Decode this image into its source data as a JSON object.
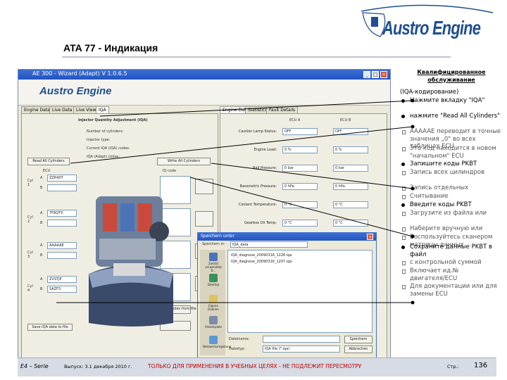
{
  "header": {
    "brand": "Austro Engine",
    "slide_title": "ATA 77 - Индикация"
  },
  "window": {
    "title": "AE 300 - Wizard (Adapt) V 1.0.6.5",
    "app_logo": "Austro Engine",
    "left_tabs": [
      "Engine Data",
      "Live Data",
      "Live View",
      "IQA"
    ],
    "right_tabs": [
      "Engine Data",
      "Statistics",
      "Fault Details"
    ],
    "panel_heading": "Injector Quantity Adjustment (IQA)",
    "left_labels": [
      "Number of cylinders:",
      "Injector type:",
      "Current IQA (IQA) codes:",
      "IQA (Adapt) codes:"
    ],
    "read_button": "Read All Cylinders",
    "write_button": "Write All Cylinders",
    "cyl_group": "ECU",
    "cyls": [
      {
        "label": "Cyl 1",
        "a": "A",
        "b": "B",
        "code": "ZZR40T"
      },
      {
        "label": "Cyl 2",
        "a": "A",
        "b": "B",
        "code": "7F8QT0"
      },
      {
        "label": "Cyl 3",
        "a": "A",
        "b": "B",
        "code": "AAAAAE"
      },
      {
        "label": "Cyl 4",
        "a": "A",
        "b": "B",
        "code": "ZVSTJP"
      }
    ],
    "cyl4_code_b": "SAZF3",
    "new_codes_label": "IQ code",
    "load_button": "Load codes from file",
    "save_button": "Save IQA data to file",
    "right_fields": [
      {
        "label": "Caution Lamp Status:",
        "v1": "OFF",
        "v2": "OFF"
      },
      {
        "label": "Engine Load:",
        "v1": "0 %",
        "v2": "0 %"
      },
      {
        "label": "Rail Pressure:",
        "v1": "0 bar",
        "v2": "0 bar"
      },
      {
        "label": "Barometric Pressure:",
        "v1": "0 hPa",
        "v2": "0 hPa"
      },
      {
        "label": "Coolant Temperature:",
        "v1": "0 °C",
        "v2": "0 °C"
      },
      {
        "label": "Gearbox Oil Temp:",
        "v1": "0 °C",
        "v2": "0 °C"
      },
      {
        "label": "Engine Speed:",
        "v1": "0 rpm",
        "v2": "0 rpm"
      },
      {
        "label": "Propeller Speed:",
        "v1": "0 rpm",
        "v2": "0 rpm"
      },
      {
        "label": "Oil Pressure:",
        "v1": "0 bar",
        "v2": "0 bar"
      }
    ],
    "right_col_heads": [
      "ECU A",
      "ECU B"
    ]
  },
  "dialog": {
    "title": "Speichern unter",
    "save_in_label": "Speichern in:",
    "save_in_value": "IQA_data",
    "places": [
      "Zuletzt verwendete D...",
      "Desktop",
      "Eigene Dateien",
      "Arbeitsplatz",
      "Netzwerkumgebung"
    ],
    "files": [
      "IQA_diagnose_20090316_1226.iqa",
      "IQA_diagnose_20090316_1207.iqa"
    ],
    "filename_label": "Dateiname:",
    "filetype_label": "Dateityp:",
    "filename_value": "IQA file (*.iqa)",
    "save_btn": "Speichern",
    "cancel_btn": "Abbrechen"
  },
  "notes": [
    {
      "kind": "head",
      "text": "Квалифицированное обслуживание"
    },
    {
      "kind": "plain",
      "text": "(IQA-кодирование)"
    },
    {
      "kind": "bul",
      "text": "Нажмите вкладку \"IQA\""
    },
    {
      "kind": "bul",
      "text": "нажмите \"Read All Cylinders\""
    },
    {
      "kind": "sub",
      "text": "AAAAAE переводит в точные значения „0\" во всех таблицах ECU"
    },
    {
      "kind": "sub",
      "text": "Это код находится в новом \"начальном\" ECU"
    },
    {
      "kind": "bul",
      "text": "Запишите коды PKBT"
    },
    {
      "kind": "sub",
      "text": "Запись всех цилиндров"
    },
    {
      "kind": "sub",
      "text": "Запись отдельных"
    },
    {
      "kind": "sub",
      "text": "Считывание"
    },
    {
      "kind": "bul",
      "text": "Введите коды PKBT"
    },
    {
      "kind": "sub",
      "text": "Загрузите из файла или"
    },
    {
      "kind": "sub",
      "text": "Наберите вручную или"
    },
    {
      "kind": "sub",
      "text": "Воспользуйтесь сканером матрицы данных"
    },
    {
      "kind": "bul",
      "text": "Сохраните данные PKBT в файл"
    },
    {
      "kind": "sub",
      "text": "с контрольной суммой"
    },
    {
      "kind": "sub",
      "text": "Включает ид.№ двигателя/ECU"
    },
    {
      "kind": "sub",
      "text": "Для документации или для замены ECU"
    }
  ],
  "footer": {
    "series": "E4 – Serie",
    "issue": "Выпуск: 3.1 декабря 2010 г.",
    "warning": "ТОЛЬКО ДЛЯ ПРИМЕНЕНИЯ В УЧЕБНЫХ ЦЕЛЯХ - НЕ ПОДЛЕЖИТ ПЕРЕСМОТРУ",
    "page_label": "Стр.:",
    "page": "136"
  },
  "colors": {
    "brand_blue": "#1f4f8f",
    "xp_title_blue": "#2254c4",
    "warning_red": "#c00000",
    "footer_bg": "#d6dbe4"
  }
}
